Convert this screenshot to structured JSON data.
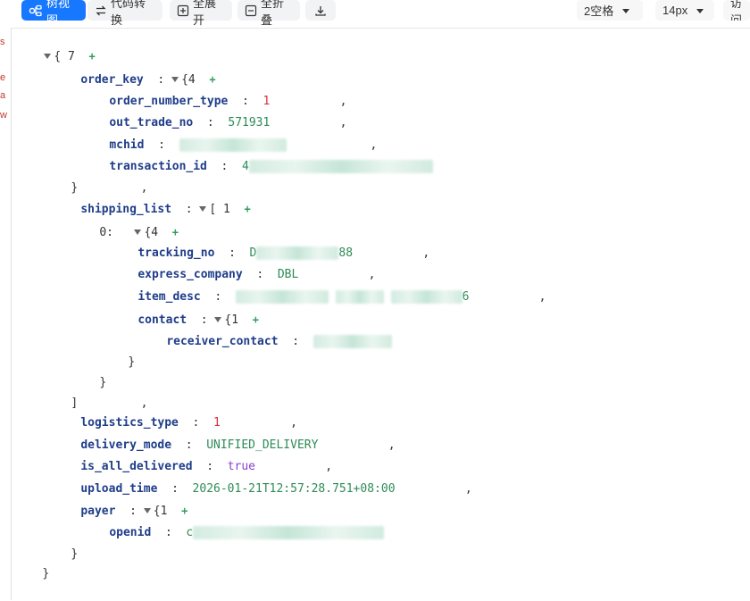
{
  "toolbar": {
    "tree_view": "树视图",
    "code_convert": "代码转换",
    "expand_all": "全展开",
    "collapse_all": "全折叠",
    "indent": "2空格",
    "font_size": "14px",
    "visit": "访问"
  },
  "gutter": {
    "c1": "s",
    "c2": "e",
    "c3": "a",
    "c4": "w"
  },
  "tree": {
    "root_brace": "{",
    "root_count": "7",
    "plus": "+",
    "colon": ":",
    "comma": ",",
    "close_brace": "}",
    "close_bracket": "]",
    "order_key": {
      "key": "order_key",
      "count": "4",
      "order_number_type": {
        "key": "order_number_type",
        "value": "1"
      },
      "out_trade_no": {
        "key": "out_trade_no",
        "value": "571931"
      },
      "mchid": {
        "key": "mchid"
      },
      "transaction_id": {
        "key": "transaction_id",
        "value_prefix": "4"
      }
    },
    "shipping_list": {
      "key": "shipping_list",
      "bracket": "[",
      "count": "1",
      "index0": "0:",
      "item_count": "4",
      "tracking_no": {
        "key": "tracking_no",
        "prefix": "D",
        "suffix": "88"
      },
      "express_company": {
        "key": "express_company",
        "value": "DBL"
      },
      "item_desc": {
        "key": "item_desc",
        "suffix": "6"
      },
      "contact": {
        "key": "contact",
        "count": "1",
        "receiver_contact": {
          "key": "receiver_contact"
        }
      }
    },
    "logistics_type": {
      "key": "logistics_type",
      "value": "1"
    },
    "delivery_mode": {
      "key": "delivery_mode",
      "value": "UNIFIED_DELIVERY"
    },
    "is_all_delivered": {
      "key": "is_all_delivered",
      "value": "true"
    },
    "upload_time": {
      "key": "upload_time",
      "value": "2026-01-21T12:57:28.751+08:00"
    },
    "payer": {
      "key": "payer",
      "count": "1",
      "openid": {
        "key": "openid",
        "prefix": "c"
      }
    }
  },
  "colors": {
    "accent": "#1677ff",
    "key": "#1f3d8a",
    "number": "#d9303a",
    "string": "#2e8b57",
    "boolean": "#8a3fd1"
  }
}
